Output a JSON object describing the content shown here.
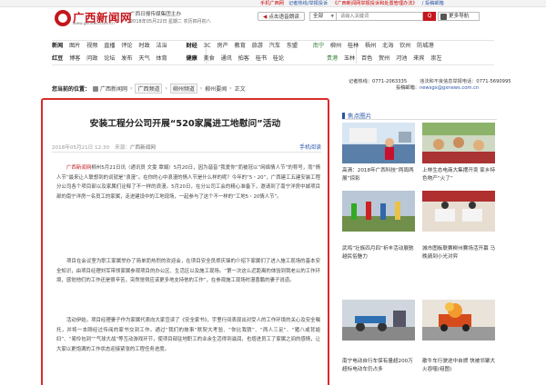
{
  "top_links": {
    "mobile": "手机广西网",
    "report": "记者热线/举报投诉",
    "campaign": "《广西新闻网举报投诉和处置管理办法》",
    "apply": "/ 投稿邮箱"
  },
  "header": {
    "logo_title": "广西新闻网",
    "logo_url": "www.gxnews.com.cn",
    "org": "广西日报传媒集团主办",
    "date": "2018年05月22日 星期二 农历四月初八",
    "voice_button": "点击语音朗读",
    "search_scope": "全部",
    "search_placeholder": "请输入关键词",
    "search_button": "Q",
    "more_button": "更多导航"
  },
  "nav": {
    "row1": [
      "新闻",
      "图片",
      "视频",
      "直播",
      "评论",
      "时政",
      "法治",
      "财经",
      "3C",
      "房产",
      "教育",
      "旅游",
      "汽车",
      "东盟",
      "南宁",
      "柳州",
      "桂林",
      "梧州",
      "北海",
      "钦州",
      "防城港"
    ],
    "row2": [
      "红豆",
      "博客",
      "问政",
      "论坛",
      "发布",
      "天气",
      "体育",
      "健康",
      "美食",
      "通讯",
      "拍客",
      "桂书",
      "桂论",
      "贵港",
      "玉林",
      "百色",
      "贺州",
      "河池",
      "来宾",
      "崇左"
    ]
  },
  "breadcrumb": {
    "lead": "您当前的位置：",
    "items": [
      "广西新闻网",
      "广西频道",
      "柳州频道",
      "柳州要闻",
      "正文"
    ],
    "separator": "›"
  },
  "hotlines": {
    "phone_label": "记者热线：",
    "phone": "0771-2063335",
    "report_label": "违法和不良信息举报电话：",
    "report_phone": "0771-5690995",
    "email_label": "投稿邮箱：",
    "email": "newsgx@gxnews.com.cn"
  },
  "article": {
    "title": "安装工程分公司开展“520家属进工地慰问”活动",
    "date": "2018年05月21日 12:30",
    "source_label": "来源：",
    "source": "广西新闻网",
    "mobile_read": "手机阅读",
    "para1_link": "广西新闻网",
    "para1": "柳州5月21日讯（通讯员 文雯 覃娟）5月20日，因为谐音“我爱你”而被冠以“网络情人节”的称号，而“情人节”最来让人联想到的词就是“浪漫”。在你的心中浪漫的情人节是什么样的呢？今年的“5・20”，广西建工五建安装工程分公司各个项目部以及家属们诠释了不一样的浪漫。5月20日，在分公司工会的精心准备下，邀请到了南宁洋房中城项目部的南宁洋房一名员工的家属，走进建设中的工地现场，一起参与了这个不一样的“工地5・20情人节”。",
    "para2": "项目在会议室为职工家属举办了简单而热烈的欢迎会，在项目安全员郑庆锋的介绍下家属们了进入施工现场的基本安全知识，由项目经理刘军带领家属参观项目的办公区、生活区以及施工现场。“第一次这么近距离的体验到我老公的工作环境，感觉他们的工作还是很辛苦，突然觉得应该更多地支持他的工作”，在参观施工现场时漫香鹏的妻子说道。",
    "para3": "活动伊始，项目经理妻子作为家属代表向大家宣读了《安全家书》，宇里行间表现出对受人的工作环境的关心及安全嘱托，并将一本刚经过传阅的家书交到工作。通过“我们的故事”默契大考验、“你比我猜”、“两人三足”、“猪八戒背媳妇”、“易怜包到”“气球大战”等互动游戏环节，使项目部驻地职工的业余生活得到滋润，也增进员工了家属之间的感情，让大家以更饱满的工作状态迎接紧张的工程任务进度。"
  },
  "right": {
    "section_title": "焦点图片",
    "items": [
      {
        "caption": "高清：2018年广西科技“两周两展”掠影"
      },
      {
        "caption": "上林生态电商大集摆开卖 家乡特色物产“火了”"
      },
      {
        "caption": "武鸣“壮族四月四”祈丰活动展驰越民俗魅力"
      },
      {
        "caption": "城市图板联赛柳州赛场活开幕 马晚骑到小光对弈"
      },
      {
        "caption": "南宁电动自行车保有量超200万 超标电动车仍占多"
      },
      {
        "caption": "散牛车行驶途中自燃 快被邻聚大火吞噬(组图)"
      }
    ]
  },
  "colors": {
    "brand_red": "#c4161c",
    "article_border": "#d92b2b",
    "link_blue": "#2a55a6"
  }
}
